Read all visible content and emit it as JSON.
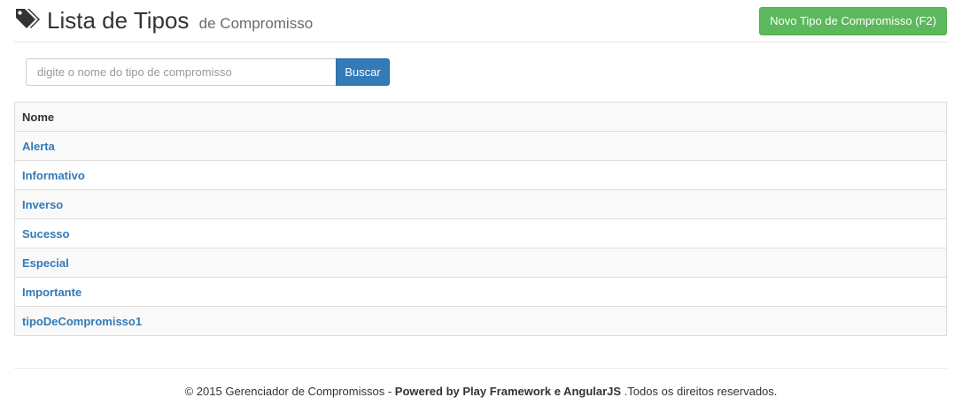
{
  "header": {
    "title": "Lista de Tipos",
    "subtitle": "de Compromisso",
    "new_button_label": "Novo Tipo de Compromisso (F2)"
  },
  "search": {
    "placeholder": "digite o nome do tipo de compromisso",
    "value": "",
    "button_label": "Buscar"
  },
  "table": {
    "column_header": "Nome",
    "rows": [
      "Alerta",
      "Informativo",
      "Inverso",
      "Sucesso",
      "Especial",
      "Importante",
      "tipoDeCompromisso1"
    ]
  },
  "footer": {
    "copyright": "© 2015 Gerenciador de Compromissos - ",
    "powered": "Powered by Play Framework e AngularJS",
    "rights": " .Todos os direitos reservados."
  },
  "icons": {
    "title_icon": "tags-icon"
  },
  "colors": {
    "primary": "#337ab7",
    "success": "#5cb85c",
    "link": "#337ab7"
  }
}
